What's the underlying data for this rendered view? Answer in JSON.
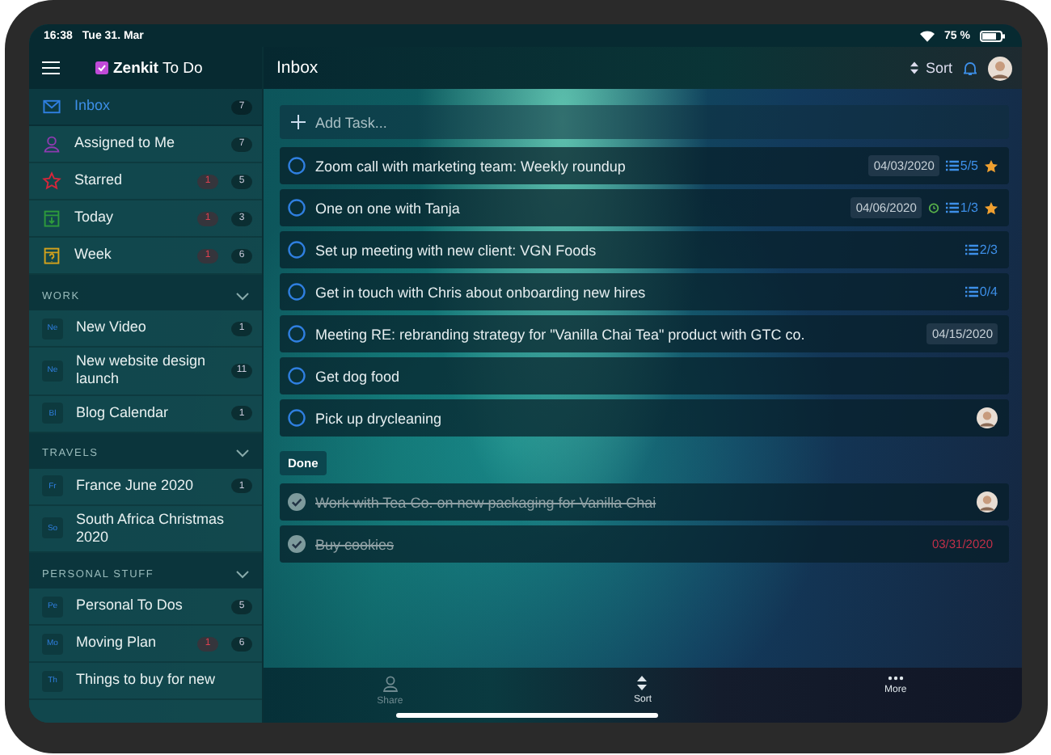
{
  "status_bar": {
    "time": "16:38",
    "date": "Tue 31. Mar",
    "battery": "75 %"
  },
  "sidebar": {
    "app_title": "**Zenkit** To Do",
    "smart_lists": [
      {
        "kind": "inbox",
        "name": "Inbox",
        "color": "#2f7fe0",
        "count": "7",
        "selected": true
      },
      {
        "kind": "assigned",
        "name": "Assigned to Me",
        "color": "#8e3bb0",
        "count": "7",
        "selected": false
      },
      {
        "kind": "starred",
        "name": "Starred",
        "color": "#d6263a",
        "overdue": "1",
        "count": "5",
        "selected": false
      },
      {
        "kind": "today",
        "name": "Today",
        "color": "#2e9a3c",
        "overdue": "1",
        "count": "3",
        "selected": false
      },
      {
        "kind": "week",
        "name": "Week",
        "color": "#d4a21c",
        "overdue": "1",
        "count": "6",
        "selected": false
      }
    ],
    "groups": [
      {
        "title": "WORK",
        "expanded": true,
        "lists": [
          {
            "abbr": "Ne",
            "name": "New Video",
            "count": "1"
          },
          {
            "abbr": "Ne",
            "name": "New website design launch",
            "count": "11"
          },
          {
            "abbr": "Bl",
            "name": "Blog Calendar",
            "count": "1"
          }
        ]
      },
      {
        "title": "TRAVELS",
        "expanded": true,
        "lists": [
          {
            "abbr": "Fr",
            "name": "France June 2020",
            "count": "1"
          },
          {
            "abbr": "So",
            "name": "South Africa Christmas 2020"
          }
        ]
      },
      {
        "title": "PERSONAL STUFF",
        "expanded": true,
        "lists": [
          {
            "abbr": "Pe",
            "name": "Personal To Dos",
            "count": "5"
          },
          {
            "abbr": "Mo",
            "name": "Moving Plan",
            "overdue": "1",
            "count": "6"
          },
          {
            "abbr": "Th",
            "name": "Things to buy for new"
          }
        ]
      }
    ]
  },
  "header": {
    "title": "Inbox",
    "sort": "Sort"
  },
  "add_task": {
    "placeholder": "Add Task..."
  },
  "tasks": [
    {
      "title": "Zoom call with marketing team: Weekly roundup",
      "date": "04/03/2020",
      "subtasks": "5/5",
      "starred": true,
      "completed": false
    },
    {
      "title": "One on one with Tanja",
      "date": "04/06/2020",
      "reminder": true,
      "subtasks": "1/3",
      "starred": true,
      "completed": false
    },
    {
      "title": "Set up meeting with new client: VGN Foods",
      "subtasks": "2/3",
      "completed": false
    },
    {
      "title": "Get in touch with Chris about onboarding new hires",
      "subtasks": "0/4",
      "completed": false
    },
    {
      "title": "Meeting RE: rebranding strategy for \"Vanilla Chai Tea\" product with GTC co.",
      "date": "04/15/2020",
      "completed": false
    },
    {
      "title": "Get dog food",
      "completed": false
    },
    {
      "title": "Pick up drycleaning",
      "assignee": true,
      "completed": false
    }
  ],
  "done_label": "Done",
  "done_tasks": [
    {
      "title": "Work with Tea Co. on new packaging for Vanilla Chai",
      "assignee": true,
      "completed": true
    },
    {
      "title": "Buy cookies",
      "date": "03/31/2020",
      "overdue": true,
      "completed": true
    }
  ],
  "bottom_bar": [
    {
      "kind": "share",
      "label": "Share",
      "disabled": true
    },
    {
      "kind": "sort",
      "label": "Sort",
      "disabled": false
    },
    {
      "kind": "more",
      "label": "More",
      "disabled": false
    }
  ]
}
